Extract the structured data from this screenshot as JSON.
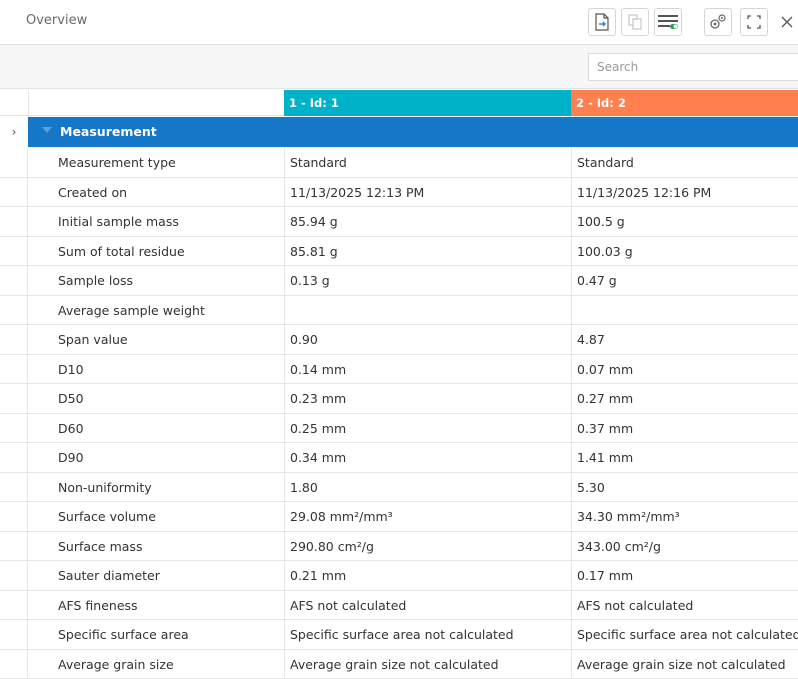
{
  "header": {
    "title": "Overview"
  },
  "toolbar": {
    "buttons": [
      {
        "icon": "export-icon"
      },
      {
        "icon": "copy-icon"
      },
      {
        "icon": "list-settings-icon"
      },
      {
        "icon": "gears-icon"
      },
      {
        "icon": "fullscreen-icon"
      },
      {
        "icon": "close-icon"
      }
    ]
  },
  "search": {
    "placeholder": "Search"
  },
  "columns": [
    {
      "label": "1 - Id: 1",
      "color": "#00b2c8"
    },
    {
      "label": "2 - Id: 2",
      "color": "#ff7f4f"
    }
  ],
  "group": {
    "label": "Measurement",
    "color": "#1477c7"
  },
  "rows": [
    {
      "label": "Measurement type",
      "v1": "Standard",
      "v2": "Standard"
    },
    {
      "label": "Created on",
      "v1": "11/13/2025 12:13 PM",
      "v2": "11/13/2025 12:16 PM"
    },
    {
      "label": "Initial sample mass",
      "v1": "85.94 g",
      "v2": "100.5 g"
    },
    {
      "label": "Sum of total residue",
      "v1": "85.81 g",
      "v2": "100.03 g"
    },
    {
      "label": "Sample loss",
      "v1": "0.13 g",
      "v2": "0.47 g"
    },
    {
      "label": "Average sample weight",
      "v1": "",
      "v2": ""
    },
    {
      "label": "Span value",
      "v1": "0.90",
      "v2": "4.87"
    },
    {
      "label": "D10",
      "v1": "0.14 mm",
      "v2": "0.07 mm"
    },
    {
      "label": "D50",
      "v1": "0.23 mm",
      "v2": "0.27 mm"
    },
    {
      "label": "D60",
      "v1": "0.25 mm",
      "v2": "0.37 mm"
    },
    {
      "label": "D90",
      "v1": "0.34 mm",
      "v2": "1.41 mm"
    },
    {
      "label": "Non-uniformity",
      "v1": "1.80",
      "v2": "5.30"
    },
    {
      "label": "Surface volume",
      "v1": "29.08 mm²/mm³",
      "v2": "34.30 mm²/mm³"
    },
    {
      "label": "Surface mass",
      "v1": "290.80 cm²/g",
      "v2": "343.00 cm²/g"
    },
    {
      "label": "Sauter diameter",
      "v1": "0.21 mm",
      "v2": "0.17 mm"
    },
    {
      "label": "AFS fineness",
      "v1": "AFS not calculated",
      "v2": "AFS not calculated"
    },
    {
      "label": "Specific surface area",
      "v1": "Specific surface area not calculated",
      "v2": "Specific surface area not calculated"
    },
    {
      "label": "Average grain size",
      "v1": "Average grain size not calculated",
      "v2": "Average grain size not calculated"
    }
  ]
}
